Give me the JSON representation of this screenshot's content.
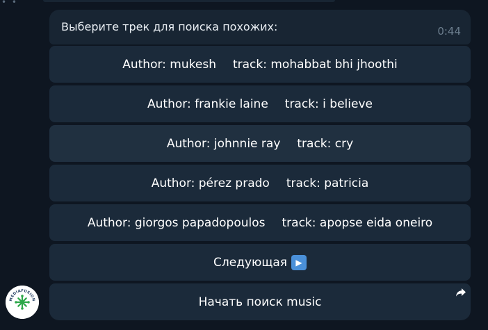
{
  "message": {
    "text": "Выберите трек для поиска похожих:",
    "time": "0:44"
  },
  "keyboard": {
    "tracks": [
      {
        "author_label": "Author: mukesh",
        "track_label": "track: mohabbat bhi jhoothi"
      },
      {
        "author_label": "Author: frankie laine",
        "track_label": "track: i believe"
      },
      {
        "author_label": "Author: johnnie ray",
        "track_label": "track: cry"
      },
      {
        "author_label": "Author: pérez prado",
        "track_label": "track: patricia"
      },
      {
        "author_label": "Author: giorgos papadopoulos",
        "track_label": "track: apopse eida oneiro"
      }
    ],
    "next_label": "Следующая",
    "next_icon": "play-button-emoji",
    "start_label": "Начать поиск music",
    "start_icon": "share-arrow-icon"
  },
  "bot_avatar": {
    "logo_text": "MEDIAFUSION"
  },
  "colors": {
    "background": "#0e1621",
    "bubble": "#182533",
    "button": "#1b2a3a",
    "button_hover": "#203040",
    "accent_green": "#2ea84a"
  }
}
